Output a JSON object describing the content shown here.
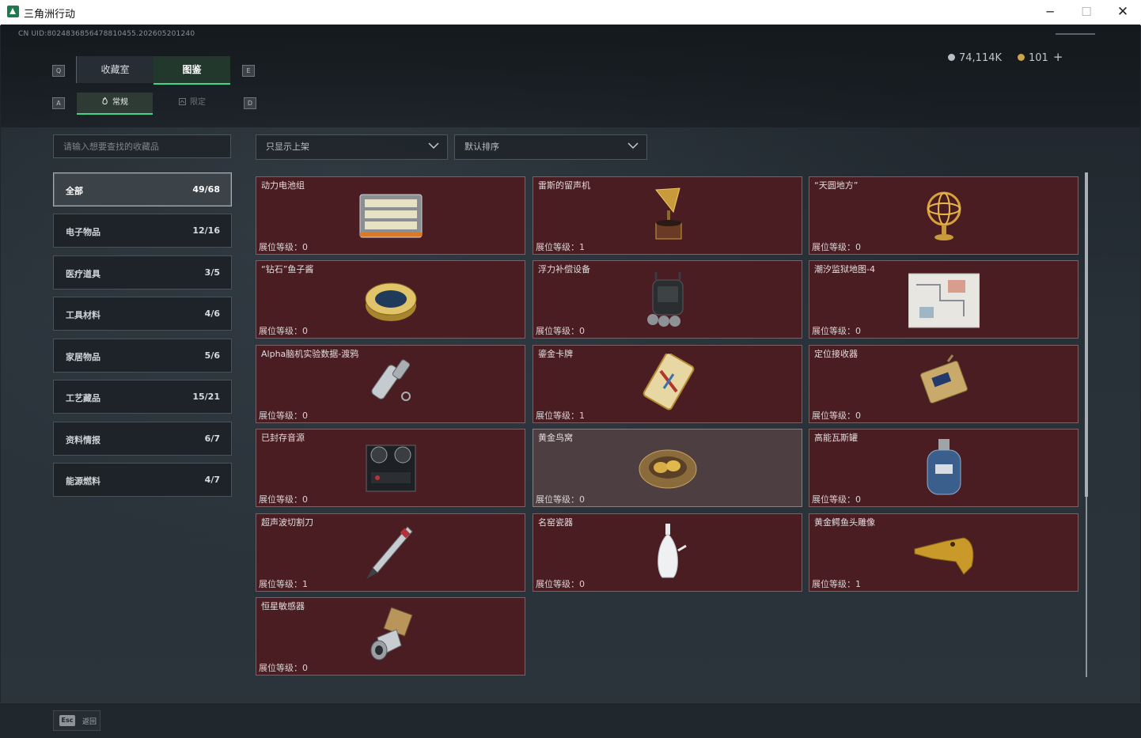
{
  "window": {
    "title": "三角洲行动",
    "controls": {
      "minimize": "─",
      "maximize": "☐",
      "close": "✕"
    }
  },
  "uid": "CN UID:8024836856478810455.202605201240",
  "currency": {
    "silver": "74,114K",
    "gold": "101",
    "add": "+"
  },
  "key_hints": {
    "q": "Q",
    "e": "E",
    "a": "A",
    "d": "D"
  },
  "tabs": {
    "main": [
      "收藏室",
      "图鉴"
    ],
    "sub": [
      "常规",
      "限定"
    ]
  },
  "search": {
    "placeholder": "请输入想要查找的收藏品"
  },
  "filters": {
    "listing": "只显示上架",
    "sort": "默认排序"
  },
  "categories": [
    {
      "label": "全部",
      "count": "49/68"
    },
    {
      "label": "电子物品",
      "count": "12/16"
    },
    {
      "label": "医疗道具",
      "count": "3/5"
    },
    {
      "label": "工具材料",
      "count": "4/6"
    },
    {
      "label": "家居物品",
      "count": "5/6"
    },
    {
      "label": "工艺藏品",
      "count": "15/21"
    },
    {
      "label": "资料情报",
      "count": "6/7"
    },
    {
      "label": "能源燃料",
      "count": "4/7"
    }
  ],
  "level_prefix": "展位等级：",
  "items": [
    {
      "name": "动力电池组",
      "level": "0",
      "icon": "battery-pack-icon"
    },
    {
      "name": "雷斯的留声机",
      "level": "1",
      "icon": "gramophone-icon"
    },
    {
      "name": "“天圆地方”",
      "level": "0",
      "icon": "armillary-sphere-icon"
    },
    {
      "name": "“钻石”鱼子酱",
      "level": "0",
      "icon": "caviar-tin-icon"
    },
    {
      "name": "浮力补偿设备",
      "level": "0",
      "icon": "buoyancy-device-icon"
    },
    {
      "name": "潮汐监狱地图-4",
      "level": "0",
      "icon": "map-icon"
    },
    {
      "name": "Alpha脑机实验数据-渡鸦",
      "level": "0",
      "icon": "data-capsule-icon"
    },
    {
      "name": "鎏金卡牌",
      "level": "1",
      "icon": "gilded-card-icon"
    },
    {
      "name": "定位接收器",
      "level": "0",
      "icon": "locator-receiver-icon"
    },
    {
      "name": "已封存音源",
      "level": "0",
      "icon": "reel-recorder-icon"
    },
    {
      "name": "黄金鸟窝",
      "level": "0",
      "icon": "golden-nest-icon"
    },
    {
      "name": "高能瓦斯罐",
      "level": "0",
      "icon": "gas-canister-icon"
    },
    {
      "name": "超声波切割刀",
      "level": "1",
      "icon": "ultrasonic-cutter-icon"
    },
    {
      "name": "名窑瓷器",
      "level": "0",
      "icon": "porcelain-vase-icon"
    },
    {
      "name": "黄金鳄鱼头雕像",
      "level": "1",
      "icon": "gold-crocodile-icon"
    },
    {
      "name": "恒星敏感器",
      "level": "0",
      "icon": "star-sensor-icon"
    }
  ],
  "footer": {
    "esc_key": "Esc",
    "esc_label": "返回"
  }
}
